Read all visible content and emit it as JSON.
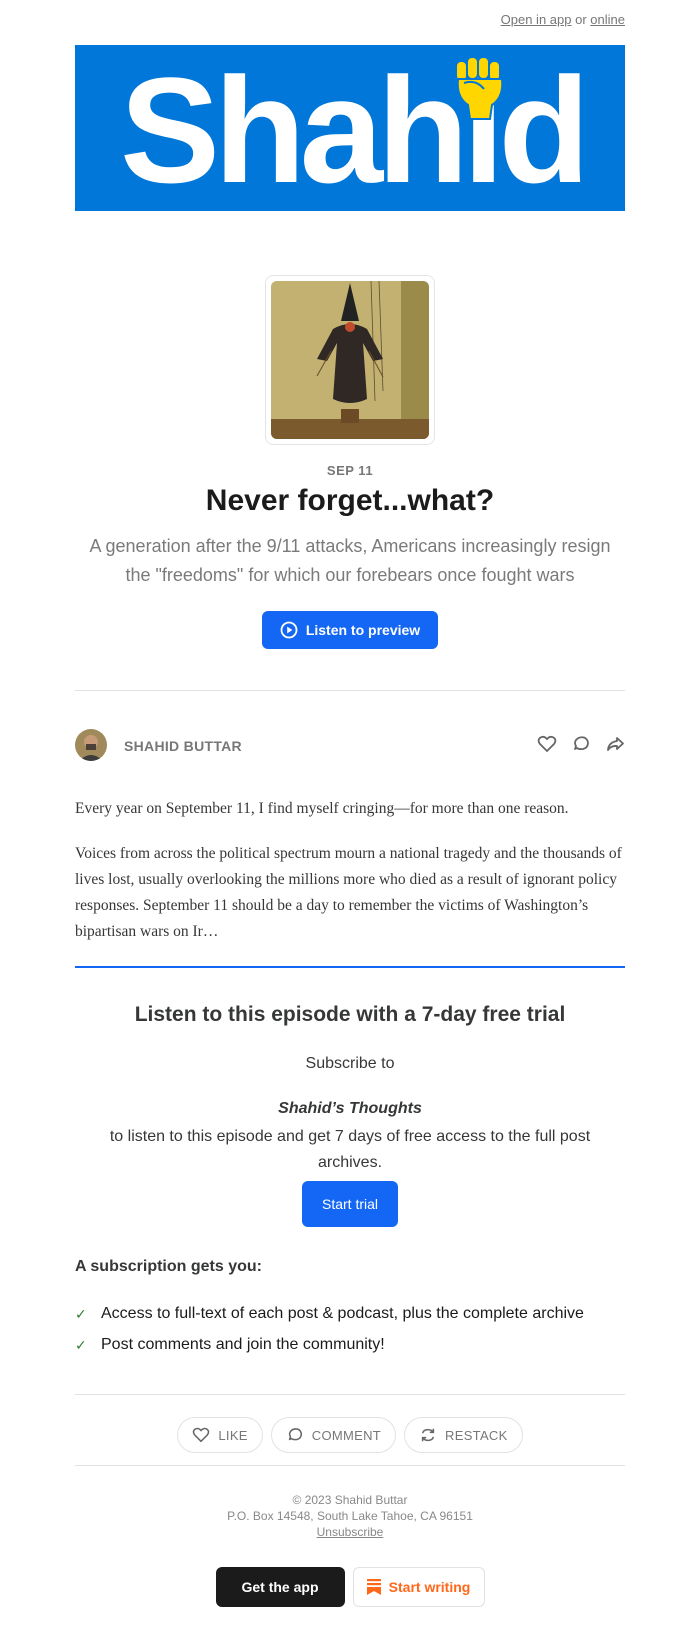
{
  "header": {
    "open_in_app": "Open in app",
    "or": "or",
    "online": "online"
  },
  "banner": {
    "wordmark": "Shahid",
    "logo_icon": "raised-fist-icon",
    "background": "#0077d9",
    "accent": "#ffd600"
  },
  "post": {
    "date": "SEP 11",
    "title": "Never forget...what?",
    "subtitle": "A generation after the 9/11 attacks, Americans increasingly resign the \"freedoms\" for which our forebears once fought wars",
    "preview_label": "Listen to preview"
  },
  "author": {
    "name": "SHAHID BUTTAR",
    "actions": [
      "heart-icon",
      "comment-icon",
      "share-icon"
    ]
  },
  "body": {
    "p1": "Every year on September 11, I find myself cringing—for more than one reason.",
    "p2": "Voices from across the political spectrum mourn a national tragedy and the thousands of lives lost, usually overlooking the millions more who died as a result of ignorant policy responses. September 11 should be a day to remember the victims of Washington’s bipartisan wars on Ir…"
  },
  "paywall": {
    "title": "Listen to this episode with a 7-day free trial",
    "subscribe_to": "Subscribe to",
    "publication": "Shahid’s Thoughts",
    "description": "to listen to this episode and get 7 days of free access to the full post archives.",
    "trial_button": "Start trial",
    "gets_heading": "A subscription gets you:",
    "benefits": [
      "Access to full-text of each post & podcast, plus the complete archive",
      "Post comments and join the community!"
    ]
  },
  "actions": {
    "like": "LIKE",
    "comment": "COMMENT",
    "restack": "RESTACK"
  },
  "footer": {
    "copyright": "© 2023 Shahid Buttar",
    "address": "P.O. Box 14548, South Lake Tahoe, CA 96151",
    "unsubscribe": "Unsubscribe",
    "get_app": "Get the app",
    "start_writing": "Start writing"
  },
  "colors": {
    "primary": "#1467f5",
    "writing_orange": "#ff6719"
  }
}
